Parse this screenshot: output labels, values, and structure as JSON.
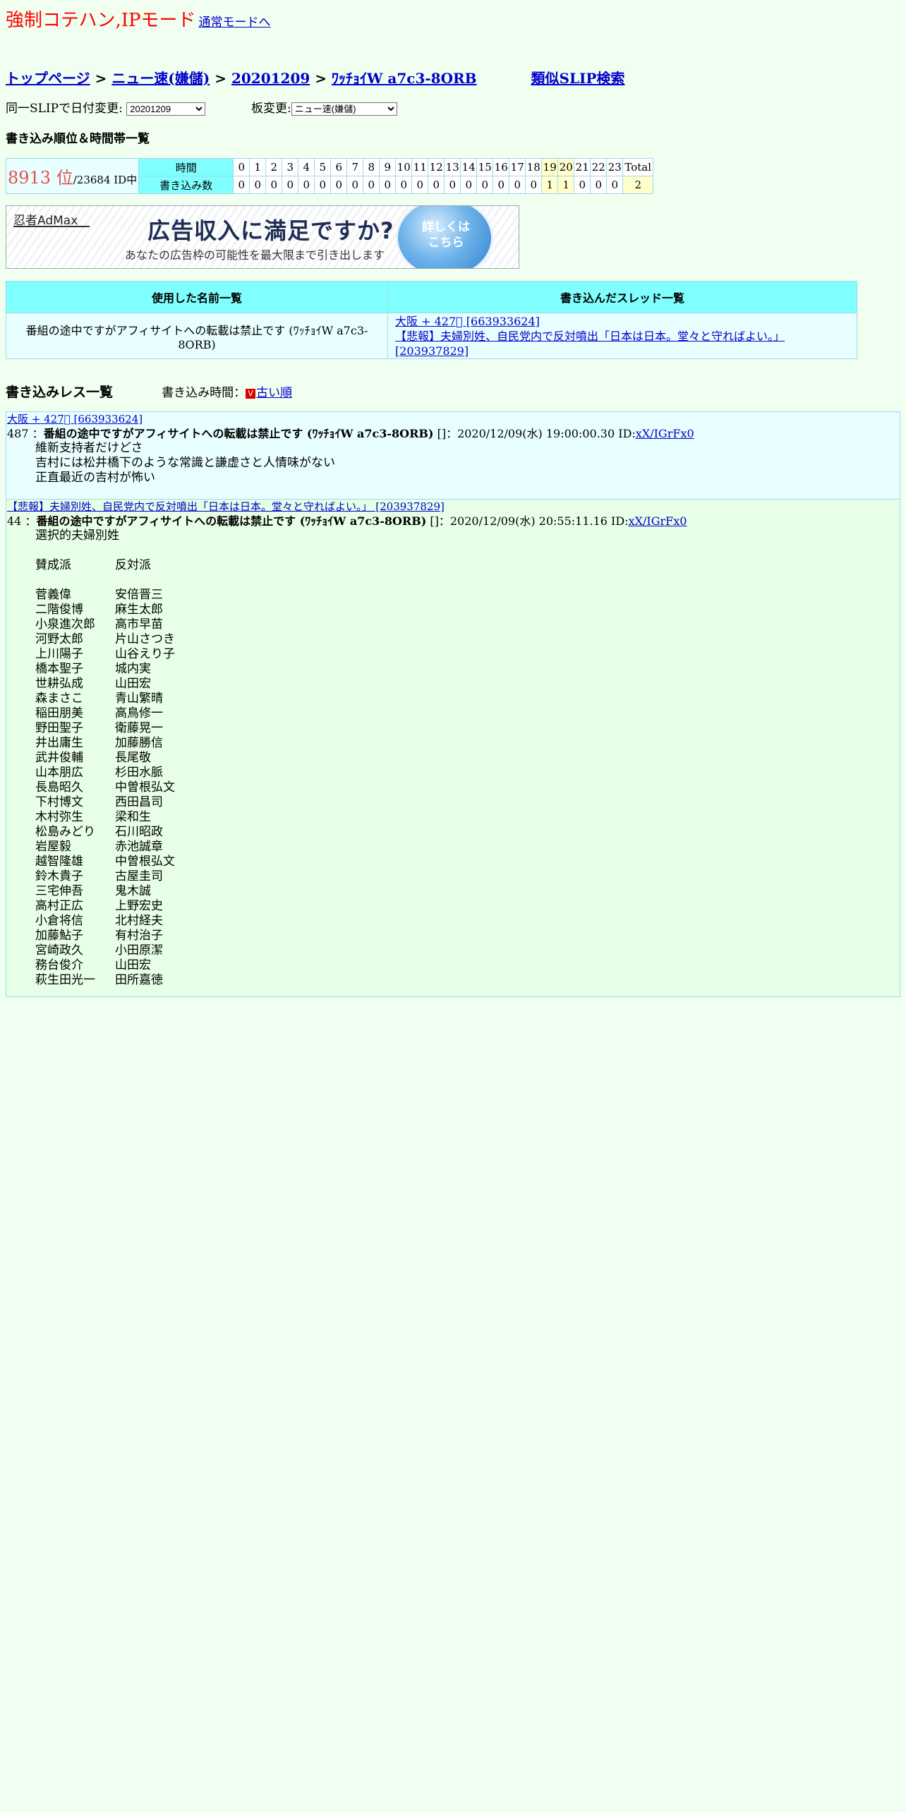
{
  "mode": {
    "title": "強制コテハン,IPモード",
    "link": "通常モードへ"
  },
  "breadcrumb": {
    "top": "トップページ",
    "sep": ">",
    "board": "ニュー速(嫌儲)",
    "date": "20201209",
    "name": "ﾜｯﾁｮｲW a7c3-8ORB",
    "similar": "類似SLIP検索"
  },
  "selectors": {
    "date_label": "同一SLIPで日付変更:",
    "date_value": "20201209",
    "board_label": "板変更:",
    "board_value": "ニュー速(嫌儲)"
  },
  "rank_heading": "書き込み順位＆時間帯一覧",
  "rank": {
    "position": "8913 位",
    "rest": "/23684 ID中"
  },
  "hours": {
    "time_label": "時間",
    "count_label": "書き込み数",
    "hours": [
      "0",
      "1",
      "2",
      "3",
      "4",
      "5",
      "6",
      "7",
      "8",
      "9",
      "10",
      "11",
      "12",
      "13",
      "14",
      "15",
      "16",
      "17",
      "18",
      "19",
      "20",
      "21",
      "22",
      "23"
    ],
    "counts": [
      "0",
      "0",
      "0",
      "0",
      "0",
      "0",
      "0",
      "0",
      "0",
      "0",
      "0",
      "0",
      "0",
      "0",
      "0",
      "0",
      "0",
      "0",
      "0",
      "1",
      "1",
      "0",
      "0",
      "0"
    ],
    "total_label": "Total",
    "total": "2"
  },
  "ad": {
    "logo": "忍者AdMax",
    "headline": "広告収入に満足ですか?",
    "sub": "あなたの広告枠の可能性を最大限まで引き出します",
    "button": "詳しくはこちら"
  },
  "names_table": {
    "col1": "使用した名前一覧",
    "col2": "書き込んだスレッド一覧",
    "name": "番組の途中ですがアフィサイトへの転載は禁止です (ﾜｯﾁｮｲW a7c3-8ORB)",
    "threads": [
      "大阪 + 427⃣ [663933624]",
      "【悲報】夫婦別姓、自民党内で反対噴出「日本は日本。堂々と守ればよい。」 [203937829]"
    ]
  },
  "posts_header": {
    "heading": "書き込みレス一覧",
    "sort_label": "書き込み時間：",
    "sort_icon": "V",
    "sort_link": "古い順"
  },
  "posts": [
    {
      "thread": "大阪 + 427⃣ [663933624]",
      "num": "487",
      "name": "番組の途中ですがアフィサイトへの転載は禁止です (ﾜｯﾁｮｲW a7c3-8ORB)",
      "date": "[]：2020/12/09(水) 19:00:00.30 ID:",
      "id": "xX/IGrFx0",
      "lines": [
        "維新支持者だけどさ",
        "吉村には松井橋下のような常識と謙虚さと人情味がない",
        "正直最近の吉村が怖い"
      ]
    },
    {
      "thread": "【悲報】夫婦別姓、自民党内で反対噴出「日本は日本。堂々と守ればよい。」 [203937829]",
      "num": "44",
      "name": "番組の途中ですがアフィサイトへの転載は禁止です (ﾜｯﾁｮｲW a7c3-8ORB)",
      "date": "[]：2020/12/09(水) 20:55:11.16 ID:",
      "id": "xX/IGrFx0",
      "intro": "選択的夫婦別姓",
      "header": [
        "賛成派",
        "反対派"
      ],
      "rows": [
        [
          "菅義偉",
          "安倍晋三"
        ],
        [
          "二階俊博",
          "麻生太郎"
        ],
        [
          "小泉進次郎",
          "高市早苗"
        ],
        [
          "河野太郎",
          "片山さつき"
        ],
        [
          "上川陽子",
          "山谷えり子"
        ],
        [
          "橋本聖子",
          "城内実"
        ],
        [
          "世耕弘成",
          "山田宏"
        ],
        [
          "森まさこ",
          "青山繁晴"
        ],
        [
          "稲田朋美",
          "高鳥修一"
        ],
        [
          "野田聖子",
          "衛藤晃一"
        ],
        [
          "井出庸生",
          "加藤勝信"
        ],
        [
          "武井俊輔",
          "長尾敬"
        ],
        [
          "山本朋広",
          "杉田水脈"
        ],
        [
          "長島昭久",
          "中曽根弘文"
        ],
        [
          "下村博文",
          "西田昌司"
        ],
        [
          "木村弥生",
          "梁和生"
        ],
        [
          "松島みどり",
          "石川昭政"
        ],
        [
          "岩屋毅",
          "赤池誠章"
        ],
        [
          "越智隆雄",
          "中曽根弘文"
        ],
        [
          "鈴木貴子",
          "古屋圭司"
        ],
        [
          "三宅伸吾",
          "鬼木誠"
        ],
        [
          "高村正広",
          "上野宏史"
        ],
        [
          "小倉将信",
          "北村経夫"
        ],
        [
          "加藤鮎子",
          "有村治子"
        ],
        [
          "宮崎政久",
          "小田原潔"
        ],
        [
          "務台俊介",
          "山田宏"
        ],
        [
          "萩生田光一",
          "田所嘉徳"
        ]
      ]
    }
  ]
}
